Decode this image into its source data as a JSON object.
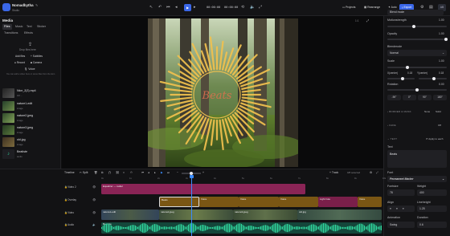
{
  "project": {
    "title": "Nomadbytha",
    "subtitle": "Studio"
  },
  "toolbar": {
    "time_current": "00:00:00",
    "time_total": "00:00:00",
    "projects": "Projects",
    "rearrange": "Rearrange",
    "auto": "Auto",
    "export": "Export",
    "avatar": "AB"
  },
  "media": {
    "title": "Media",
    "tabs": [
      "Files",
      "Music",
      "Text",
      "Sticker"
    ],
    "tabs2": [
      "Transitions",
      "Effects"
    ],
    "drop_text": "Drop files here",
    "add_files": "Add files",
    "subtitles": "Subtitles",
    "record": "Record",
    "camera": "Camera",
    "voice": "Voice",
    "hint": "You can add a video here or some files from the item",
    "files": [
      {
        "name": "Nice_2(3).mp4",
        "type": "3/2 ..."
      },
      {
        "name": "nature1-edit",
        "type": "image"
      },
      {
        "name": "nature2.jpeg",
        "type": "image"
      },
      {
        "name": "nature3.jpeg",
        "type": "image"
      },
      {
        "name": "old.jpg",
        "type": "image"
      },
      {
        "name": "Beatiste",
        "type": "audio"
      }
    ]
  },
  "preview": {
    "zoom": "1:1"
  },
  "props": {
    "blend_label": "Blend mode",
    "motion_label": "Motionstrength",
    "motion_value": "1.00",
    "opacity_label": "Opacity",
    "opacity_value": "1.00",
    "blend_mode_label": "Blendmode",
    "blend_mode_value": "Normal",
    "scale_label": "Scale",
    "scale_value": "1.00",
    "x_label": "X(center)",
    "x_value": "0.18",
    "y_label": "Y(center)",
    "y_value": "0.18",
    "rotation_label": "Rotation",
    "rotation_value": "0.00",
    "rotations": [
      "-90°",
      "0°",
      "90°",
      "180°"
    ],
    "border_section": "BORDER & MASK",
    "border_none": "None",
    "border_solid": "Solid",
    "fade_section": "FADE",
    "fade_value": "Off",
    "text_section": "TEXT",
    "text_apply": "Apply to each",
    "text_label": "Text",
    "text_value": "Beats",
    "font_label": "Font",
    "font_value": "Permanent Marker",
    "fontsize_label": "Fontsize",
    "fontsize_value": "78",
    "weight_label": "Weight",
    "weight_value": "400",
    "align_label": "Align",
    "lineheight_label": "Lineheight",
    "lineheight_value": "1.25",
    "animation_label": "Animation",
    "animation_value": "Swing",
    "duration_label": "Duration",
    "duration_value": "0.6"
  },
  "timeline": {
    "label": "Timeline",
    "split": "Split",
    "track_btn": "Track",
    "selected": "0/8 selected",
    "ticks": [
      "0s",
      "1s",
      "2s",
      "3s",
      "4s",
      "5s",
      "6s",
      "7s",
      "8s",
      "9s",
      "10s"
    ],
    "tracks": [
      "Video 2",
      "Overlay",
      "Video",
      "Audio"
    ],
    "clips_video2": [
      {
        "label": "Equalizer — radial",
        "color": "#8a2456"
      }
    ],
    "clips_overlay": [
      {
        "label": "Beats",
        "color": "#7a5614"
      },
      {
        "label": "Voice",
        "color": "#7a5614"
      },
      {
        "label": "Voice",
        "color": "#7a5614"
      },
      {
        "label": "Voice",
        "color": "#7a5614"
      },
      {
        "label": "Light hole",
        "color": "#7a1f4a"
      },
      {
        "label": "Voice",
        "color": "#7a5614"
      }
    ],
    "clips_video": [
      {
        "label": "nature1-edit",
        "color": "#33455a"
      },
      {
        "label": "nature2.jpeg",
        "color": "#3b4c3a"
      },
      {
        "label": "nature3.jpeg",
        "color": "#3a4a34"
      },
      {
        "label": "old.jpg",
        "color": "#344a40"
      }
    ],
    "clips_audio": [
      {
        "label": "Beatiste",
        "color": "#1b7a55"
      }
    ]
  },
  "colors": {
    "accent": "#3a67e8",
    "waveform": "#2fd19a",
    "sunburst": "#f2c14e"
  }
}
